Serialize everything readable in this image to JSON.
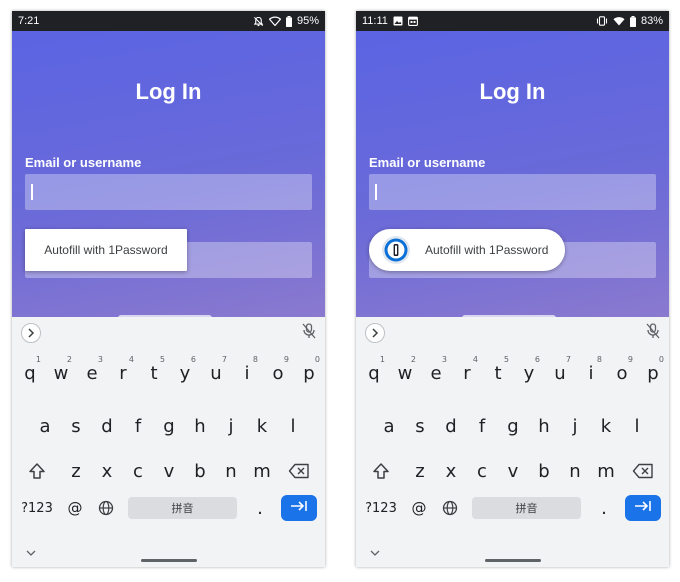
{
  "panels": [
    {
      "status": {
        "time": "7:21",
        "battery": "95%"
      },
      "title": "Log In",
      "email_label": "Email or username",
      "autofill_label": "Autofill with 1Password",
      "keyboard": {
        "row1": [
          "q",
          "w",
          "e",
          "r",
          "t",
          "y",
          "u",
          "i",
          "o",
          "p"
        ],
        "row1_hints": [
          "1",
          "2",
          "3",
          "4",
          "5",
          "6",
          "7",
          "8",
          "9",
          "0"
        ],
        "row2": [
          "a",
          "s",
          "d",
          "f",
          "g",
          "h",
          "j",
          "k",
          "l"
        ],
        "row3": [
          "z",
          "x",
          "c",
          "v",
          "b",
          "n",
          "m"
        ],
        "symbols_key": "?123",
        "at_key": "@",
        "space_label": "拼音",
        "period_key": "."
      }
    },
    {
      "status": {
        "time": "11:11",
        "battery": "83%"
      },
      "title": "Log In",
      "email_label": "Email or username",
      "autofill_label": "Autofill with 1Password",
      "keyboard": {
        "row1": [
          "q",
          "w",
          "e",
          "r",
          "t",
          "y",
          "u",
          "i",
          "o",
          "p"
        ],
        "row1_hints": [
          "1",
          "2",
          "3",
          "4",
          "5",
          "6",
          "7",
          "8",
          "9",
          "0"
        ],
        "row2": [
          "a",
          "s",
          "d",
          "f",
          "g",
          "h",
          "j",
          "k",
          "l"
        ],
        "row3": [
          "z",
          "x",
          "c",
          "v",
          "b",
          "n",
          "m"
        ],
        "symbols_key": "?123",
        "at_key": "@",
        "space_label": "拼音",
        "period_key": "."
      }
    }
  ],
  "colors": {
    "gradient_start": "#5b64e3",
    "gradient_end": "#8a79cf",
    "enter_key": "#1a73e8",
    "onepassword_blue": "#0a6fd6",
    "status_bar": "#202124"
  },
  "icons": [
    "notifications-off-icon",
    "wifi-icon",
    "battery-icon",
    "image-icon",
    "calendar-icon",
    "vibrate-icon",
    "keyboard-expand-icon",
    "mic-off-icon",
    "shift-icon",
    "backspace-icon",
    "globe-icon",
    "enter-arrow-icon",
    "keyboard-collapse-icon",
    "onepassword-logo-icon"
  ]
}
